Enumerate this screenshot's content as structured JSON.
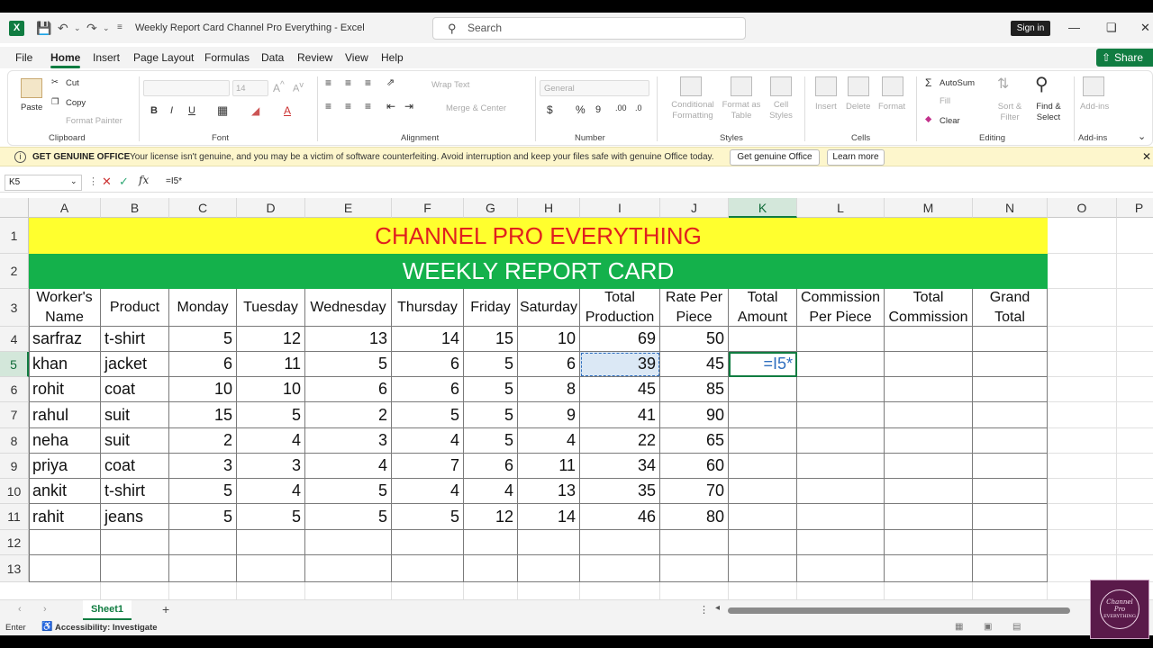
{
  "titlebar": {
    "title": "Weekly Report Card Channel Pro Everything  -  Excel",
    "search_placeholder": "Search",
    "signin_label": "Sign in"
  },
  "menu": [
    "File",
    "Home",
    "Insert",
    "Page Layout",
    "Formulas",
    "Data",
    "Review",
    "View",
    "Help"
  ],
  "share_label": "Share",
  "ribbon": {
    "clipboard": {
      "label": "Clipboard",
      "paste": "Paste",
      "cut": "Cut",
      "copy": "Copy",
      "format_painter": "Format Painter"
    },
    "font": {
      "label": "Font",
      "size": "14"
    },
    "alignment": {
      "label": "Alignment",
      "wrap": "Wrap Text",
      "merge": "Merge & Center"
    },
    "number": {
      "label": "Number",
      "format": "General"
    },
    "styles": {
      "label": "Styles",
      "conditional": "Conditional Formatting",
      "format_table": "Format as Table",
      "cell_styles": "Cell Styles"
    },
    "cells": {
      "label": "Cells",
      "insert": "Insert",
      "delete": "Delete",
      "format": "Format"
    },
    "editing": {
      "label": "Editing",
      "autosum": "AutoSum",
      "fill": "Fill",
      "clear": "Clear",
      "sort": "Sort & Filter",
      "find": "Find & Select"
    },
    "addins": {
      "label": "Add-ins",
      "addins": "Add-ins"
    }
  },
  "message_bar": {
    "title": "GET GENUINE OFFICE",
    "text": "Your license isn't genuine, and you may be a victim of software counterfeiting. Avoid interruption and keep your files safe with genuine Office today.",
    "button1": "Get genuine Office",
    "button2": "Learn more"
  },
  "formula_bar": {
    "name_box": "K5",
    "formula": "=I5*"
  },
  "columns": [
    "A",
    "B",
    "C",
    "D",
    "E",
    "F",
    "G",
    "H",
    "I",
    "J",
    "K",
    "L",
    "M",
    "N",
    "O",
    "P"
  ],
  "rows": [
    "1",
    "2",
    "3",
    "4",
    "5",
    "6",
    "7",
    "8",
    "9",
    "10",
    "11",
    "12",
    "13"
  ],
  "sheet": {
    "title1": "CHANNEL PRO EVERYTHING",
    "title2": "WEEKLY REPORT CARD",
    "headers": [
      "Worker's Name",
      "Product",
      "Monday",
      "Tuesday",
      "Wednesday",
      "Thursday",
      "Friday",
      "Saturday",
      "Total Production",
      "Rate Per Piece",
      "Total Amount",
      "Commission Per Piece",
      "Total Commission",
      "Grand Total"
    ],
    "data": [
      [
        "sarfraz",
        "t-shirt",
        "5",
        "12",
        "13",
        "14",
        "15",
        "10",
        "69",
        "50"
      ],
      [
        "khan",
        "jacket",
        "6",
        "11",
        "5",
        "6",
        "5",
        "6",
        "39",
        "45"
      ],
      [
        "rohit",
        "coat",
        "10",
        "10",
        "6",
        "6",
        "5",
        "8",
        "45",
        "85"
      ],
      [
        "rahul",
        "suit",
        "15",
        "5",
        "2",
        "5",
        "5",
        "9",
        "41",
        "90"
      ],
      [
        "neha",
        "suit",
        "2",
        "4",
        "3",
        "4",
        "5",
        "4",
        "22",
        "65"
      ],
      [
        "priya",
        "coat",
        "3",
        "3",
        "4",
        "7",
        "6",
        "11",
        "34",
        "60"
      ],
      [
        "ankit",
        "t-shirt",
        "5",
        "4",
        "5",
        "4",
        "4",
        "13",
        "35",
        "70"
      ],
      [
        "rahit",
        "jeans",
        "5",
        "5",
        "5",
        "5",
        "12",
        "14",
        "46",
        "80"
      ]
    ],
    "editing_cell": "=I5*",
    "editing_ref": "I5"
  },
  "sheet_tab": "Sheet1",
  "status": {
    "mode": "Enter",
    "accessibility": "Accessibility: Investigate"
  },
  "watermark": {
    "line1": "Channel Pro",
    "line2": "EVERYTHING"
  },
  "colors": {
    "yellow": "#FFFF2E",
    "green": "#14B14B",
    "title_red": "#E0201E",
    "excel_green": "#107C41"
  }
}
